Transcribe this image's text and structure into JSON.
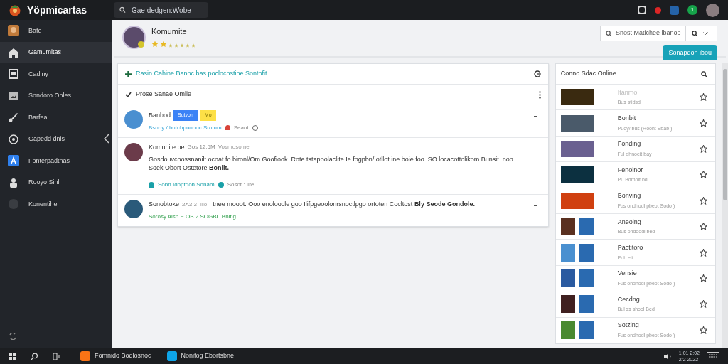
{
  "app": {
    "title": "Yöpmicartas",
    "search_placeholder": "Gae dedgen:Wobe"
  },
  "top_icons": [
    {
      "kind": "puzzle"
    },
    {
      "kind": "alert",
      "color": "#dc2626"
    },
    {
      "kind": "mail",
      "color": "#2563a8"
    },
    {
      "kind": "chat",
      "color": "#16a34a",
      "badge": "1"
    },
    {
      "kind": "avatar"
    }
  ],
  "sidebar": {
    "items": [
      {
        "label": "Bafe",
        "selected": false
      },
      {
        "label": "Gamumitas",
        "selected": true
      },
      {
        "label": "Cadiny",
        "selected": false
      },
      {
        "label": "Sondoro Onles",
        "selected": false
      },
      {
        "label": "Barfea",
        "selected": false
      },
      {
        "label": "Gapedd dnis",
        "selected": false
      },
      {
        "label": "Fonterpadtnas",
        "selected": false
      },
      {
        "label": "Rooyo Sinl",
        "selected": false
      },
      {
        "label": "Konentihe",
        "selected": false
      }
    ]
  },
  "profile": {
    "name": "Komumite",
    "stars": 2
  },
  "search_box": {
    "placeholder": "Snost Matichee lbanoo"
  },
  "action_button": "Sonapdon ibou",
  "feed": {
    "banner": "Rasin Cahine Banoc bas poclocnstine Sontofit.",
    "filter": "Prose Sanae Omlie",
    "posts": [
      {
        "kind": "tagged",
        "author": "Banbod",
        "tags": [
          {
            "label": "Sutvon",
            "color": "#3b82f6"
          },
          {
            "label": "Mo",
            "color": "#fde047"
          }
        ],
        "meta": "Bsony / butchpuonoc Srotum",
        "extra": "Seaot"
      },
      {
        "kind": "comment",
        "author": "Komunite.be",
        "time": "Gos 12:5M",
        "sub": "Vosmosome",
        "text": "Gosdouvcoossnanilt ocoat fo bironl/Om Goofiook. Rote tstapoolaclite Ie fogpbn/ otllot ine boie foo. SO locacottolikom Bunsit. noo Soek Obort Ostetore **Bonlit.**",
        "action": "Sonn Idoptdon Sonam",
        "count": "Sosot : Ilfe"
      },
      {
        "kind": "comment",
        "author": "Sonobtoke",
        "time": "2A3 3",
        "sub": "Ilio",
        "text": "tnee mooot. Ooo enoloocle goo Ilifpgeoolonrsnoctlpgo ortoten Cocltost **Bly Seode Gondole.**",
        "action": "Sorosy Alsn E.OB 2 SOGBI",
        "count": "Bnitig."
      }
    ]
  },
  "online": {
    "title": "Conno Sdac Online",
    "items": [
      {
        "kind": "single",
        "title": "Itanmo",
        "sub": "Bus stidsd",
        "muted": true
      },
      {
        "kind": "single",
        "title": "Bonbit",
        "sub": "Puoy/ bus (Hoont Sbab )",
        "muted": false
      },
      {
        "kind": "single",
        "title": "Fonding",
        "sub": "Ful dhnoeit bay",
        "muted": false
      },
      {
        "kind": "single",
        "title": "Fenolnor",
        "sub": "Pu Bdmolt bd",
        "muted": false
      },
      {
        "kind": "single",
        "title": "Bonving",
        "sub": "Fus ondhodl pbeot Sodo )",
        "muted": false
      },
      {
        "kind": "double",
        "title": "Aneoing",
        "sub": "Bus ondoodl bed",
        "muted": false
      },
      {
        "kind": "double",
        "title": "Pactitoro",
        "sub": "Eub ett",
        "muted": false
      },
      {
        "kind": "double",
        "title": "Vensie",
        "sub": "Fus ondhodl pbeot Sodo )",
        "muted": false
      },
      {
        "kind": "double",
        "title": "Cecdng",
        "sub": "Bul ss shool Bed",
        "muted": false
      },
      {
        "kind": "double",
        "title": "Sotzing",
        "sub": "Fus ondhodl pbeot Sodo )",
        "muted": false
      }
    ]
  },
  "taskbar": {
    "apps": [
      {
        "label": "Fomnido Bodlosnoc",
        "color": "#f97316"
      },
      {
        "label": "Nonifog Ebortsbne",
        "color": "#0ea5e9"
      }
    ],
    "time": "1:01 2:02",
    "date": "2/2 2022"
  }
}
